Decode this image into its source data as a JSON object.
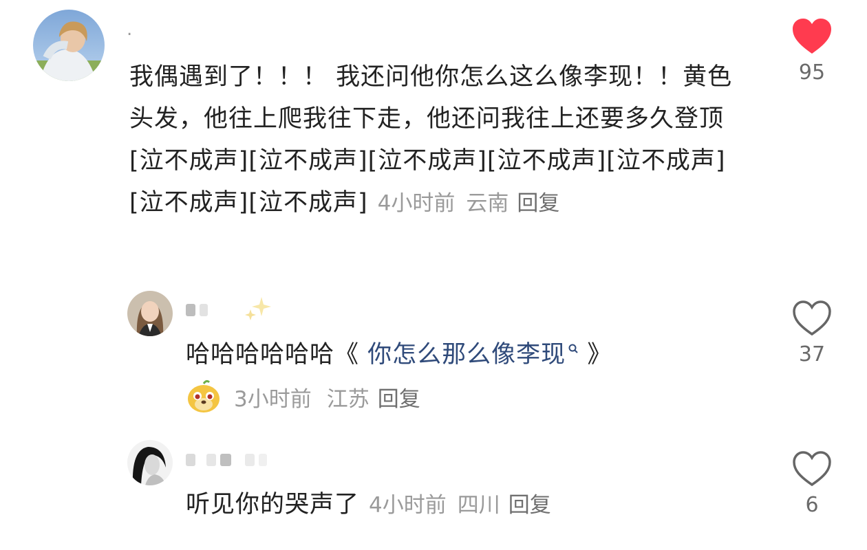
{
  "main_comment": {
    "username": ".",
    "text": "我偶遇到了！！！ 我还问他你怎么这么像李现！！黄色头发，他往上爬我往下走，他还问我往上还要多久登顶[泣不成声][泣不成声][泣不成声][泣不成声][泣不成声][泣不成声][泣不成声]",
    "time": "4小时前",
    "location": "云南",
    "reply_label": "回复",
    "likes": "95",
    "liked": true
  },
  "replies": [
    {
      "text_prefix": "哈哈哈哈哈哈《",
      "link_text": "你怎么那么像李现",
      "text_suffix": "》",
      "time": "3小时前",
      "location": "江苏",
      "reply_label": "回复",
      "likes": "37",
      "liked": false
    },
    {
      "text": "听见你的哭声了",
      "time": "4小时前",
      "location": "四川",
      "reply_label": "回复",
      "likes": "6",
      "liked": false
    }
  ],
  "icons": {
    "liked_heart": "heart-filled-icon",
    "unliked_heart": "heart-outline-icon",
    "search": "search-icon",
    "sparkle": "sparkles-icon",
    "sticker": "doge-sticker-icon"
  },
  "colors": {
    "like_red": "#ff3b4f",
    "link_blue": "#2f4a7a",
    "meta_gray": "#9a9a9a"
  }
}
